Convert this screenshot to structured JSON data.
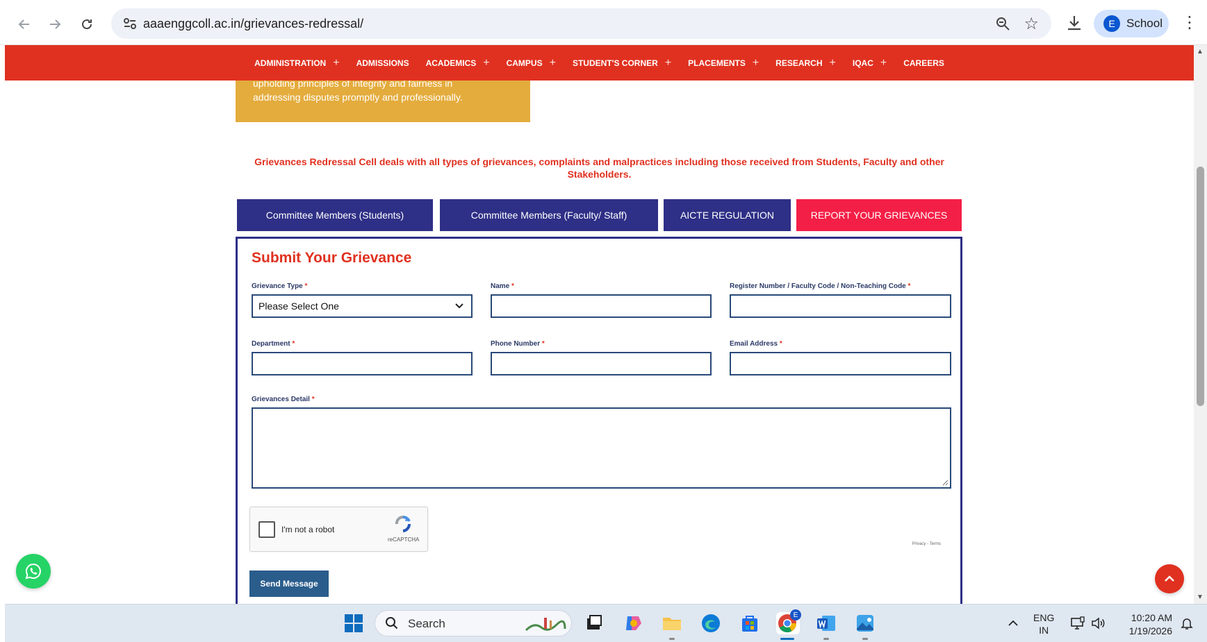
{
  "browser": {
    "url": "aaaenggcoll.ac.in/grievances-redressal/",
    "profile_initial": "E",
    "profile_name": "School"
  },
  "nav": {
    "items": [
      {
        "label": "ADMINISTRATION",
        "plus": true
      },
      {
        "label": "ADMISSIONS",
        "plus": false
      },
      {
        "label": "ACADEMICS",
        "plus": true
      },
      {
        "label": "CAMPUS",
        "plus": true
      },
      {
        "label": "STUDENT'S CORNER",
        "plus": true
      },
      {
        "label": "PLACEMENTS",
        "plus": true
      },
      {
        "label": "RESEARCH",
        "plus": true
      },
      {
        "label": "IQAC",
        "plus": true
      },
      {
        "label": "CAREERS",
        "plus": false
      }
    ],
    "plus_symbol": "+"
  },
  "intro_box": {
    "line1": "upholding principles of integrity and fairness in",
    "line2": "addressing disputes promptly and professionally."
  },
  "intro_text": "Grievances Redressal Cell deals with all types of grievances, complaints and malpractices including those received from Students, Faculty and other Stakeholders.",
  "tabs": [
    {
      "label": "Committee Members (Students)"
    },
    {
      "label": "Committee Members (Faculty/ Staff)"
    },
    {
      "label": "AICTE REGULATION"
    },
    {
      "label": "REPORT YOUR GRIEVANCES"
    }
  ],
  "form": {
    "title": "Submit Your Grievance",
    "required_mark": "*",
    "grievance_type_label": "Grievance Type",
    "grievance_type_value": "Please Select One",
    "name_label": "Name",
    "name_value": "",
    "register_label": "Register Number / Faculty Code / Non-Teaching Code",
    "register_value": "",
    "department_label": "Department",
    "department_value": "",
    "phone_label": "Phone Number",
    "phone_value": "",
    "email_label": "Email Address",
    "email_value": "",
    "detail_label": "Grievances Detail",
    "detail_value": "",
    "captcha_text": "I'm not a robot",
    "captcha_brand": "reCAPTCHA",
    "captcha_links": "Privacy - Terms",
    "submit_label": "Send Message"
  },
  "taskbar": {
    "search_label": "Search",
    "lang_line1": "ENG",
    "lang_line2": "IN",
    "time": "10:20 AM",
    "date": "1/19/2026",
    "chrome_badge": "E"
  },
  "colors": {
    "nav_red": "#e03120",
    "tab_navy": "#2e2f86",
    "tab_active": "#f41f46",
    "whatsapp_green": "#26d366",
    "button_blue": "#2a5d8c",
    "intro_box": "#e4ac3d"
  }
}
